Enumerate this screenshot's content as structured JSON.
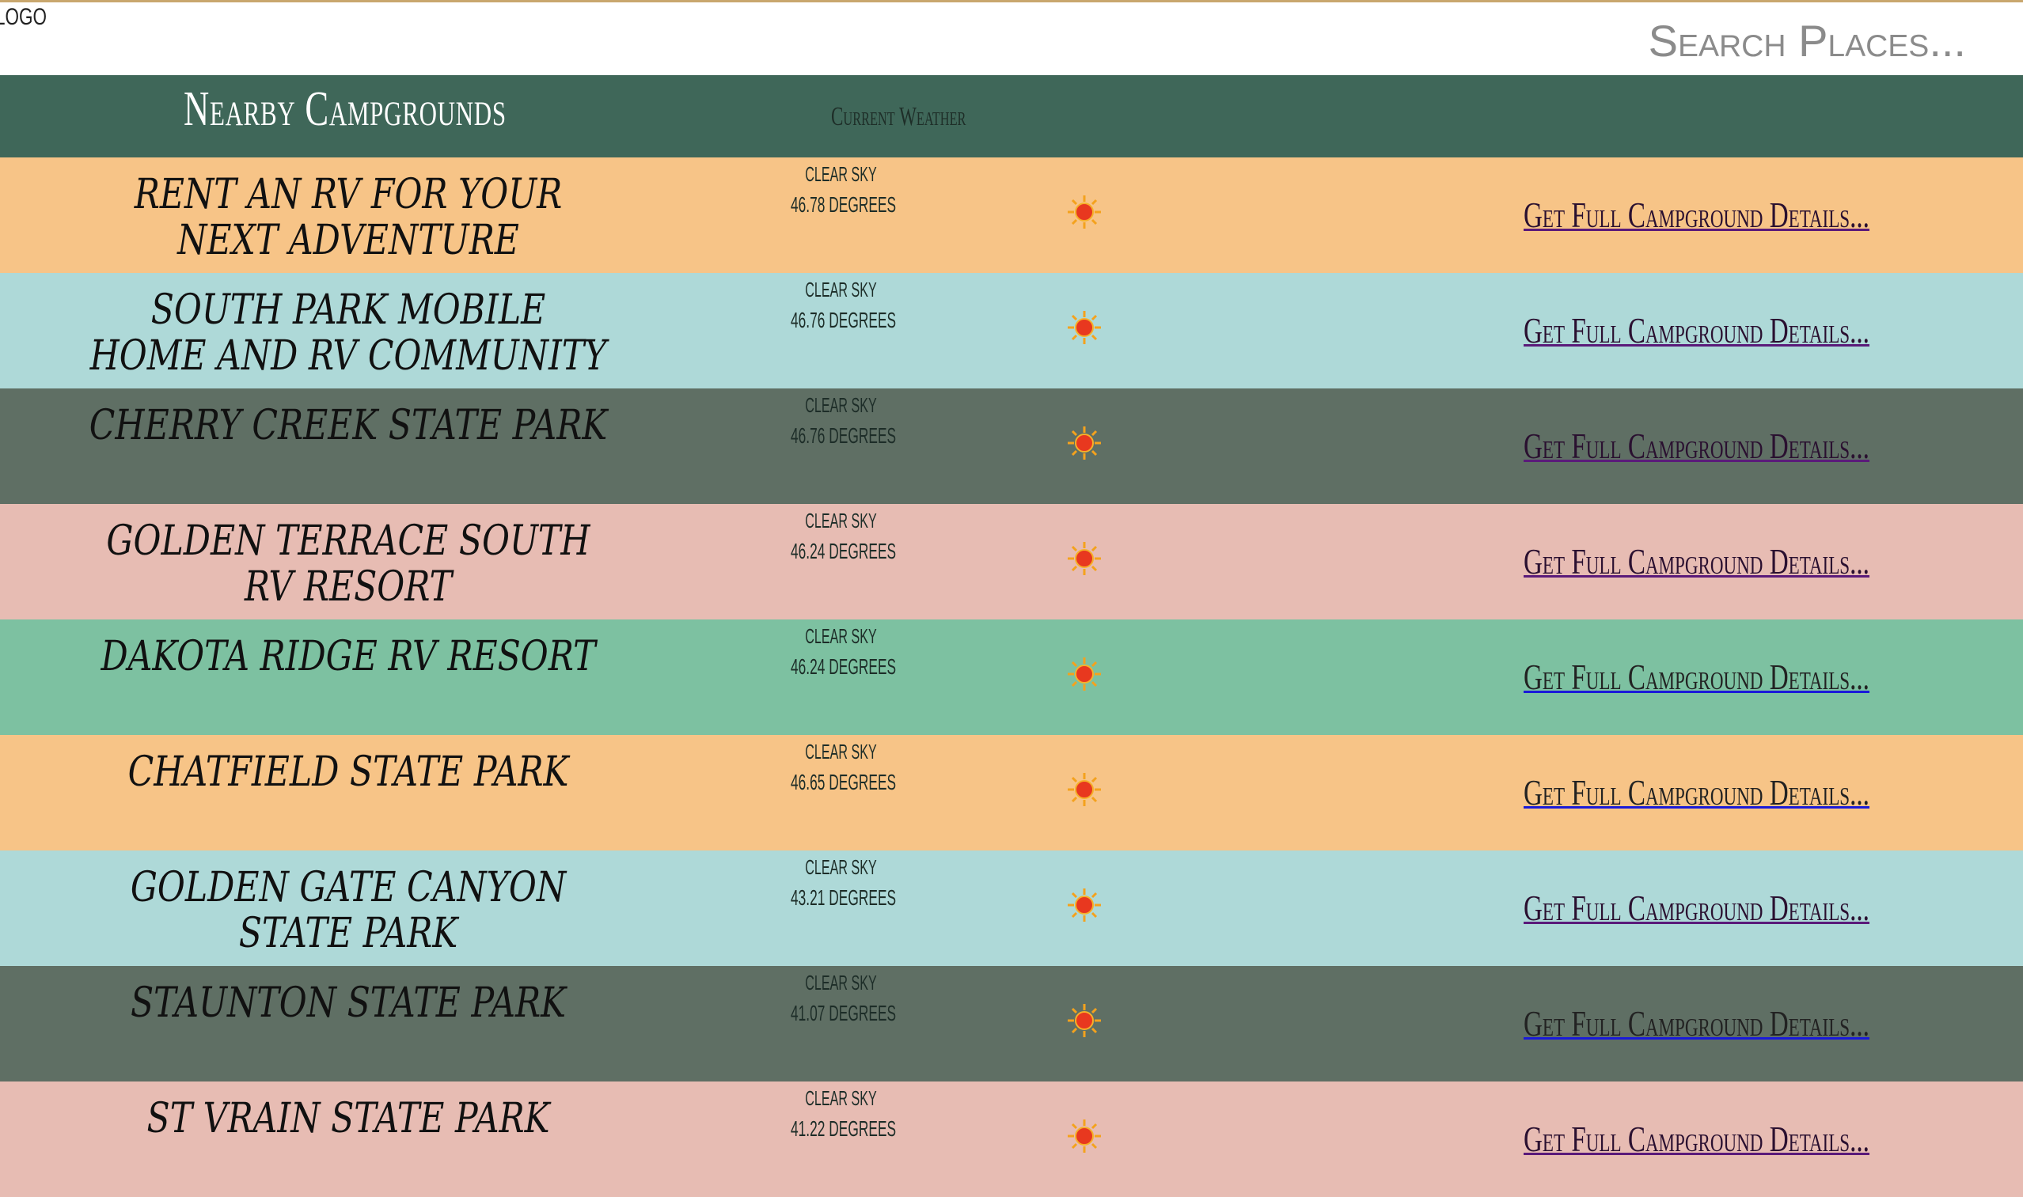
{
  "topbar": {
    "logo": "LOGO",
    "search_placeholder": "Search Places..."
  },
  "header": {
    "title": "Nearby Campgrounds",
    "weather_label": "Current Weather"
  },
  "sun_icon": "sun-icon",
  "colors": {
    "header_bg": "#3f6759",
    "orange": "#f7c487",
    "teal": "#aed9d8",
    "slate": "#5f6f64",
    "pink": "#e7bcb3",
    "green": "#7dc1a1"
  },
  "campgrounds": [
    {
      "name": "Rent an RV for your next adventure",
      "condition": "clear sky",
      "temp": "46.78 degrees",
      "link": "Get Full Campground Details..."
    },
    {
      "name": "South Park Mobile Home and RV Community",
      "condition": "clear sky",
      "temp": "46.76 degrees",
      "link": "Get Full Campground Details..."
    },
    {
      "name": "Cherry Creek State Park",
      "condition": "clear sky",
      "temp": "46.76 degrees",
      "link": "Get Full Campground Details..."
    },
    {
      "name": "Golden Terrace South RV Resort",
      "condition": "clear sky",
      "temp": "46.24 degrees",
      "link": "Get Full Campground Details..."
    },
    {
      "name": "Dakota Ridge RV Resort",
      "condition": "clear sky",
      "temp": "46.24 degrees",
      "link": "Get Full Campground Details..."
    },
    {
      "name": "Chatfield State Park",
      "condition": "clear sky",
      "temp": "46.65 degrees",
      "link": "Get Full Campground Details..."
    },
    {
      "name": "Golden Gate Canyon State Park",
      "condition": "clear sky",
      "temp": "43.21 degrees",
      "link": "Get Full Campground Details..."
    },
    {
      "name": "Staunton State Park",
      "condition": "clear sky",
      "temp": "41.07 degrees",
      "link": "Get Full Campground Details..."
    },
    {
      "name": "St Vrain State Park",
      "condition": "clear sky",
      "temp": "41.22 degrees",
      "link": "Get Full Campground Details..."
    }
  ]
}
